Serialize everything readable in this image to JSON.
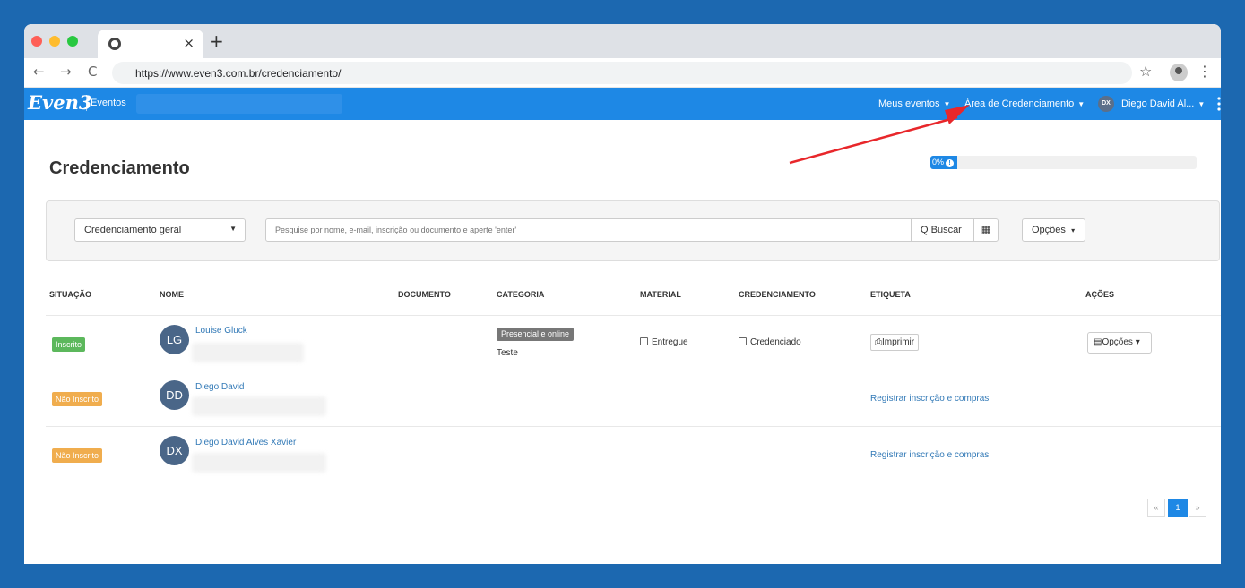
{
  "browser": {
    "tab_close": "×",
    "new_tab": "+",
    "url": "https://www.even3.com.br/credenciamento/",
    "back": "←",
    "forward": "→",
    "reload": "C",
    "bookmark": "☆",
    "menu": "⋮"
  },
  "nav": {
    "logo": "Even3",
    "section": "Eventos",
    "meus_eventos": "Meus eventos",
    "area_credenciamento": "Área de Credenciamento",
    "user_initials": "DX",
    "user_name": "Diego David Al..."
  },
  "page": {
    "title": "Credenciamento",
    "progress_label": "0%",
    "progress_value": 0
  },
  "filters": {
    "select_value": "Credenciamento geral",
    "search_placeholder": "Pesquise por nome, e-mail, inscrição ou documento e aperte 'enter'",
    "search_button": "Q Buscar",
    "options_button": "Opções"
  },
  "table": {
    "headers": [
      "SITUAÇÃO",
      "NOME",
      "DOCUMENTO",
      "CATEGORIA",
      "MATERIAL",
      "CREDENCIAMENTO",
      "ETIQUETA",
      "AÇÕES"
    ],
    "rows": [
      {
        "status": "Inscrito",
        "initials": "LG",
        "name": "Louise Gluck",
        "category_badge": "Presencial e online",
        "category_text": "Teste",
        "material": "Entregue",
        "credential": "Credenciado",
        "label_button": "Imprimir",
        "actions_button": "Opções"
      },
      {
        "status": "Não Inscrito",
        "initials": "DD",
        "name": "Diego David",
        "register_link": "Registrar inscrição e compras"
      },
      {
        "status": "Não Inscrito",
        "initials": "DX",
        "name": "Diego David Alves Xavier",
        "register_link": "Registrar inscrição e compras"
      }
    ]
  },
  "pagination": {
    "prev": "«",
    "current": "1",
    "next": "»"
  },
  "colors": {
    "background": "#1c68b0",
    "nav": "#1e88e5",
    "badge_inscrito": "#5cb85c",
    "badge_nao_inscrito": "#f0ad4e",
    "annotation_arrow": "#e8272b"
  }
}
